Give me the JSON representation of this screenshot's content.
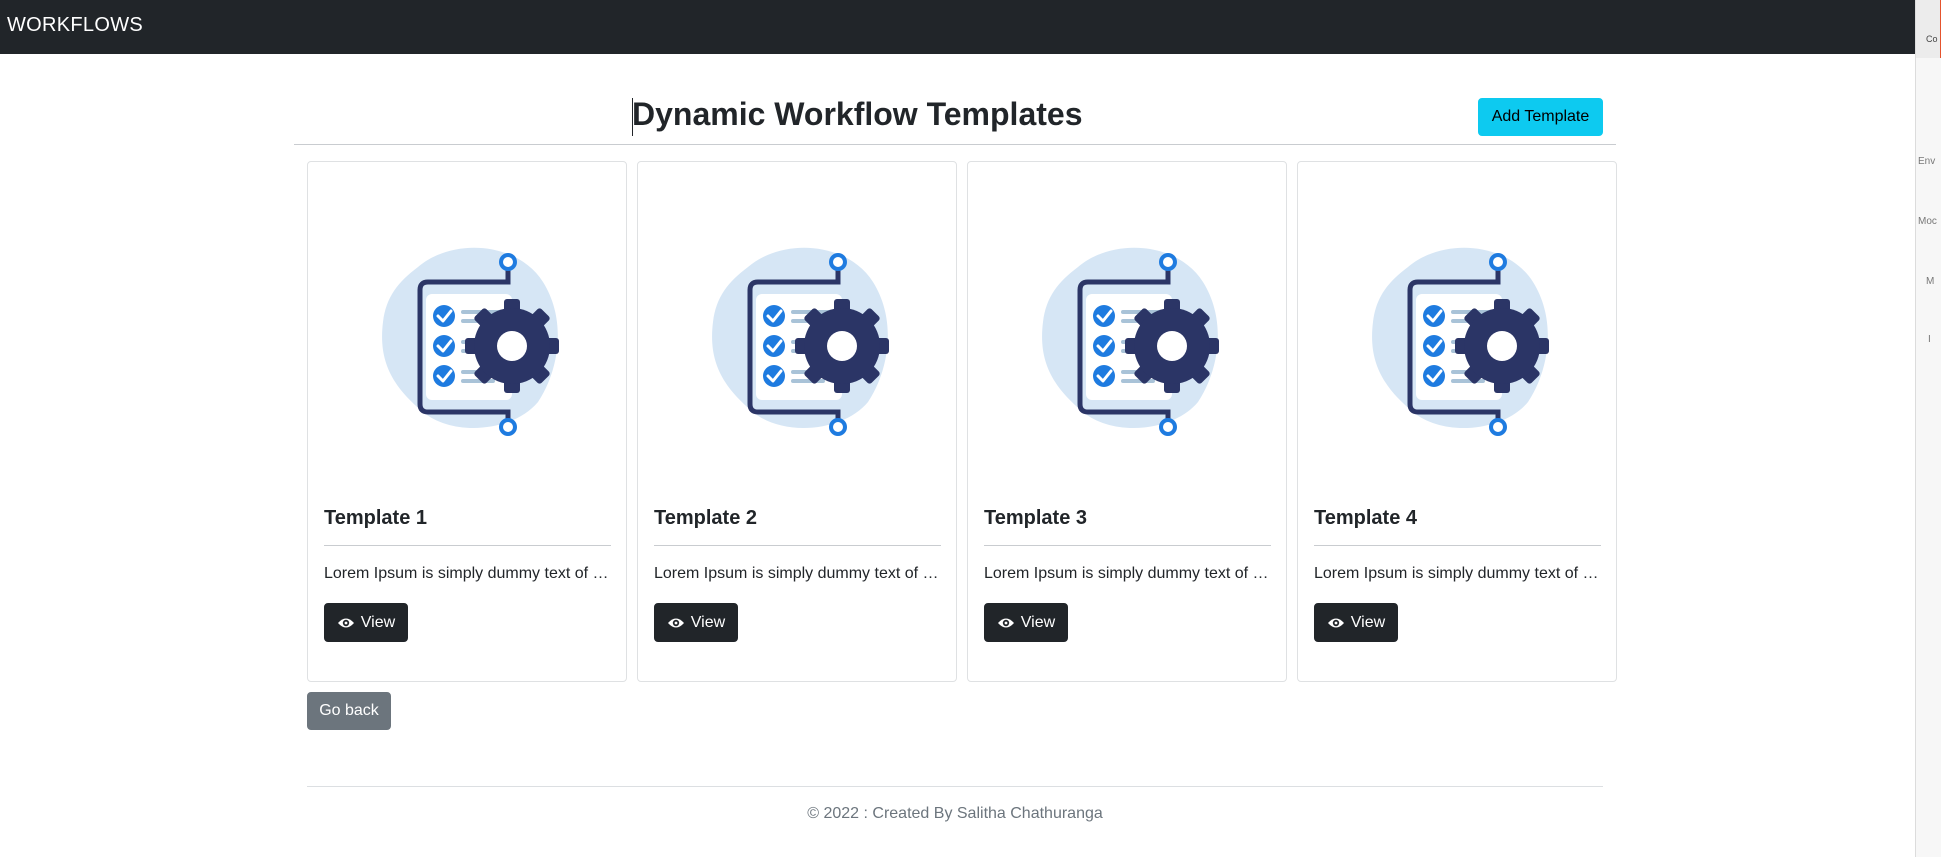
{
  "navbar": {
    "brand": "WORKFLOWS"
  },
  "side_panel": {
    "tabs": [
      "Co",
      "Env",
      "Moc",
      "M",
      "I"
    ]
  },
  "header": {
    "title": "Dynamic Workflow Templates",
    "add_button": "Add Template"
  },
  "icons": {
    "card_image": "workflow-checklist-gear-illustration",
    "view": "eye-icon"
  },
  "colors": {
    "navbar": "#212529",
    "add_button": "#0dcaf0",
    "view_button": "#212529",
    "back_button": "#6c757d",
    "illustration_blob": "#d6e6f5",
    "illustration_navy": "#2b3566",
    "illustration_blue": "#1e7be0"
  },
  "cards": [
    {
      "title": "Template 1",
      "text": "Lorem Ipsum is simply dummy text of the printing and typesetting industry.",
      "button": "View"
    },
    {
      "title": "Template 2",
      "text": "Lorem Ipsum is simply dummy text of the printing and typesetting industry.",
      "button": "View"
    },
    {
      "title": "Template 3",
      "text": "Lorem Ipsum is simply dummy text of the printing and typesetting industry.",
      "button": "View"
    },
    {
      "title": "Template 4",
      "text": "Lorem Ipsum is simply dummy text of the printing and typesetting industry.",
      "button": "View"
    }
  ],
  "back_button": "Go back",
  "footer": {
    "text": "© 2022 : Created By Salitha Chathuranga"
  }
}
